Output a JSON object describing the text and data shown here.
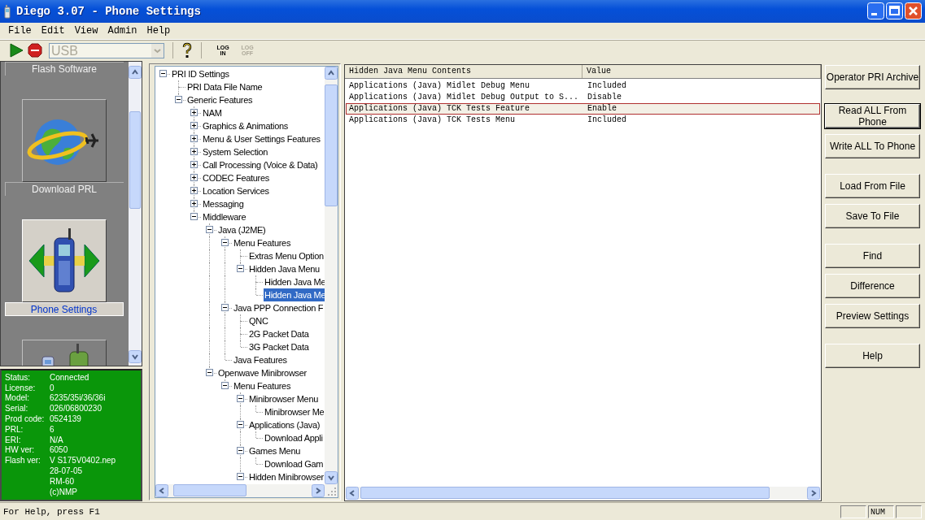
{
  "window": {
    "title": "Diego 3.07 - Phone Settings"
  },
  "menu": [
    "File",
    "Edit",
    "View",
    "Admin",
    "Help"
  ],
  "toolbar": {
    "port": {
      "value": "USB",
      "disabled": true
    },
    "log_in": {
      "label": "LOG IN",
      "disabled": false
    },
    "log_off": {
      "label": "LOG OFF",
      "disabled": true
    }
  },
  "sidebar": {
    "items": [
      {
        "label": "Flash Software",
        "kind": "flash",
        "selected": false
      },
      {
        "label": "Download PRL",
        "kind": "globe",
        "selected": false
      },
      {
        "label": "Phone Settings",
        "kind": "phone",
        "selected": true
      },
      {
        "kind": "devices",
        "selected": false
      }
    ]
  },
  "phone_info": [
    {
      "label": "Status:",
      "value": "Connected"
    },
    {
      "label": "License:",
      "value": "0"
    },
    {
      "label": "Model:",
      "value": "6235/35i/36/36i"
    },
    {
      "label": "Serial:",
      "value": "026/06800230"
    },
    {
      "label": "Prod code:",
      "value": "0524139"
    },
    {
      "label": "PRL:",
      "value": "6"
    },
    {
      "label": "ERI:",
      "value": "N/A"
    },
    {
      "label": "HW ver:",
      "value": "6050"
    },
    {
      "label": "Flash ver:",
      "value": "V S175V0402.nep"
    },
    {
      "value": "28-07-05"
    },
    {
      "value": "RM-60"
    },
    {
      "value": "(c)NMP"
    }
  ],
  "tree": [
    {
      "label": "PRI ID Settings",
      "expanded": true,
      "selected": false,
      "children": [
        {
          "label": "PRI Data File Name",
          "selected": false
        },
        {
          "label": "Generic Features",
          "expanded": true,
          "selected": false,
          "children": [
            {
              "label": "NAM",
              "expanded": false,
              "selected": false
            },
            {
              "label": "Graphics & Animations",
              "expanded": false,
              "selected": false
            },
            {
              "label": "Menu & User Settings Features",
              "expanded": false,
              "selected": false
            },
            {
              "label": "System Selection",
              "expanded": false,
              "selected": false
            },
            {
              "label": "Call Processing (Voice & Data)",
              "expanded": false,
              "selected": false
            },
            {
              "label": "CODEC Features",
              "expanded": false,
              "selected": false
            },
            {
              "label": "Location Services",
              "expanded": false,
              "selected": false
            },
            {
              "label": "Messaging",
              "expanded": false,
              "selected": false
            },
            {
              "label": "Middleware",
              "expanded": true,
              "selected": false,
              "children": [
                {
                  "label": "Java (J2ME)",
                  "expanded": true,
                  "selected": false,
                  "children": [
                    {
                      "label": "Menu Features",
                      "expanded": true,
                      "selected": false,
                      "children": [
                        {
                          "label": "Extras Menu Option",
                          "selected": false
                        },
                        {
                          "label": "Hidden Java Menu",
                          "expanded": true,
                          "selected": false,
                          "children": [
                            {
                              "label": "Hidden Java Me",
                              "selected": false
                            },
                            {
                              "label": "Hidden Java Me",
                              "selected": true
                            }
                          ]
                        }
                      ]
                    },
                    {
                      "label": "Java PPP Connection F",
                      "expanded": true,
                      "selected": false,
                      "children": [
                        {
                          "label": "QNC",
                          "selected": false
                        },
                        {
                          "label": "2G Packet Data",
                          "selected": false
                        },
                        {
                          "label": "3G Packet Data",
                          "selected": false
                        }
                      ]
                    },
                    {
                      "label": "Java Features",
                      "selected": false
                    }
                  ]
                },
                {
                  "label": "Openwave Minibrowser",
                  "expanded": true,
                  "selected": false,
                  "children": [
                    {
                      "label": "Menu Features",
                      "expanded": true,
                      "selected": false,
                      "children": [
                        {
                          "label": "Minibrowser Menu",
                          "expanded": true,
                          "selected": false,
                          "children": [
                            {
                              "label": "Minibrowser Me",
                              "selected": false
                            }
                          ]
                        },
                        {
                          "label": "Applications (Java)",
                          "expanded": true,
                          "selected": false,
                          "children": [
                            {
                              "label": "Download Appli",
                              "selected": false
                            }
                          ]
                        },
                        {
                          "label": "Games Menu",
                          "expanded": true,
                          "selected": false,
                          "children": [
                            {
                              "label": "Download Gam",
                              "selected": false
                            }
                          ]
                        },
                        {
                          "label": "Hidden Minibrowser",
                          "expanded": true,
                          "selected": false
                        }
                      ]
                    }
                  ]
                }
              ]
            }
          ]
        }
      ]
    }
  ],
  "table": {
    "columns": [
      "Hidden Java Menu Contents",
      "Value"
    ],
    "rows": [
      {
        "cells": [
          "Applications (Java) Midlet Debug Menu",
          "Included"
        ],
        "selected": false
      },
      {
        "cells": [
          "Applications (Java) Midlet Debug Output to S...",
          "Disable"
        ],
        "selected": false
      },
      {
        "cells": [
          "Applications (Java) TCK Tests Feature",
          "Enable"
        ],
        "selected": true
      },
      {
        "cells": [
          "Applications (Java) TCK Tests Menu",
          "Included"
        ],
        "selected": false
      }
    ]
  },
  "buttons": [
    {
      "label": "Operator PRI Archive",
      "default": false
    },
    {
      "label": "Read ALL From Phone",
      "default": true
    },
    {
      "label": "Write ALL To Phone",
      "default": false
    },
    {
      "label": "Load From File",
      "default": false
    },
    {
      "label": "Save To File",
      "default": false
    },
    {
      "label": "Find",
      "default": false
    },
    {
      "label": "Difference",
      "default": false
    },
    {
      "label": "Preview Settings",
      "default": false
    },
    {
      "label": "Help",
      "default": false
    }
  ],
  "status_bar": {
    "text": "For Help, press F1",
    "panes": [
      "NUM"
    ]
  }
}
